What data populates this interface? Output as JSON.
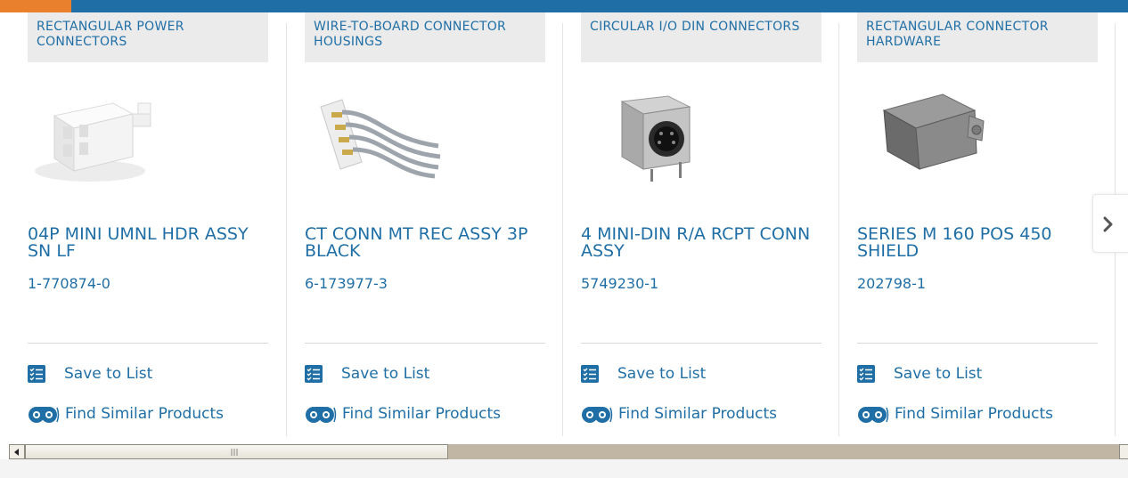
{
  "products": [
    {
      "category": "RECTANGULAR POWER CONNECTORS",
      "title": "04P MINI UMNL HDR ASSY SN LF",
      "part_number": "1-770874-0",
      "save_label": "Save to List",
      "similar_label": "Find Similar Products",
      "image_icon": "white-rectangular-connector-image"
    },
    {
      "category": "WIRE-TO-BOARD CONNECTOR HOUSINGS",
      "title": "CT CONN MT REC ASSY 3P BLACK",
      "part_number": "6-173977-3",
      "save_label": "Save to List",
      "similar_label": "Find Similar Products",
      "image_icon": "wire-to-board-housing-image"
    },
    {
      "category": "CIRCULAR I/O DIN CONNECTORS",
      "title": "4 MINI-DIN R/A RCPT CONN ASSY",
      "part_number": "5749230-1",
      "save_label": "Save to List",
      "similar_label": "Find Similar Products",
      "image_icon": "mini-din-receptacle-image"
    },
    {
      "category": "RECTANGULAR CONNECTOR HARDWARE",
      "title": "SERIES M 160 POS 450 SHIELD",
      "part_number": "202798-1",
      "save_label": "Save to List",
      "similar_label": "Find Similar Products",
      "image_icon": "metal-shield-image"
    }
  ],
  "icons": {
    "save": "checklist-icon",
    "similar": "binoculars-icon",
    "next": "chevron-right-icon"
  },
  "colors": {
    "brand_blue": "#1f6fa6",
    "accent_orange": "#e8802d",
    "category_bg": "#ebebeb"
  }
}
